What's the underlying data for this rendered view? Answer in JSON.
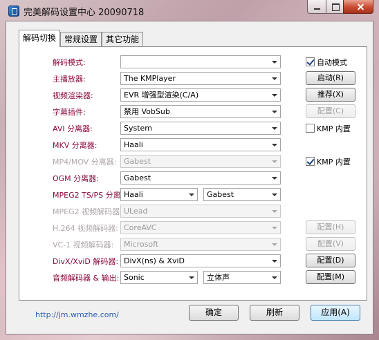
{
  "window": {
    "title": "完美解码设置中心 20090718",
    "icon": "app-icon"
  },
  "tabs": [
    {
      "label": "解码切换",
      "active": true
    },
    {
      "label": "常规设置",
      "active": false
    },
    {
      "label": "其它功能",
      "active": false
    }
  ],
  "rows": {
    "decode_mode": {
      "label": "解码模式:",
      "value": ""
    },
    "main_player": {
      "label": "主播放器:",
      "value": "The KMPlayer"
    },
    "video_renderer": {
      "label": "视频渲染器:",
      "value": "EVR 增强型渲染(C/A)"
    },
    "subtitle_plugin": {
      "label": "字幕插件:",
      "value": "禁用 VobSub"
    },
    "avi_splitter": {
      "label": "AVI 分离器:",
      "value": "System"
    },
    "mkv_splitter": {
      "label": "MKV 分离器:",
      "value": "Haali"
    },
    "mp4_splitter": {
      "label": "MP4/MOV 分离器:",
      "value": "Gabest"
    },
    "ogm_splitter": {
      "label": "OGM 分离器:",
      "value": "Gabest"
    },
    "mpeg2ts_splitter": {
      "label": "MPEG2 TS/PS 分离器:",
      "value1": "Haali",
      "value2": "Gabest"
    },
    "mpeg2_decoder": {
      "label": "MPEG2 视频解码器:",
      "value": "ULead"
    },
    "h264_decoder": {
      "label": "H.264 视频解码器:",
      "value": "CoreAVC"
    },
    "vc1_decoder": {
      "label": "VC-1 视频解码器:",
      "value": "Microsoft"
    },
    "divx_decoder": {
      "label": "DivX/XviD 解码器:",
      "value": "DivX(ns) & XviD"
    },
    "audio_decoder": {
      "label": "音频解码器 & 输出:",
      "value1": "Sonic",
      "value2": "立体声"
    }
  },
  "side": {
    "auto_mode": {
      "label": "自动模式",
      "checked": true
    },
    "launch": "启动(R)",
    "recommend": "推荐(X)",
    "config_c": "配置(C)",
    "avi_kmp": {
      "label": "KMP 内置",
      "checked": false
    },
    "mp4_kmp": {
      "label": "KMP 内置",
      "checked": true
    },
    "config_h": "配置(H)",
    "config_v": "配置(V)",
    "config_d": "配置(D)",
    "config_m": "配置(M)"
  },
  "footer": {
    "link": "http://jm.wmzhe.com/",
    "ok": "确定",
    "refresh": "刷新",
    "apply": "应用(A)"
  }
}
